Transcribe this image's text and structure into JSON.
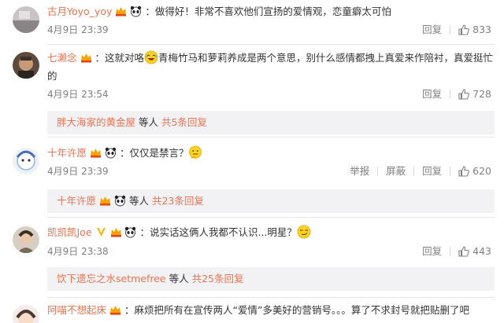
{
  "comments": [
    {
      "user": "古月Yoyo_yoy",
      "text": "：做得好！非常不喜欢他们宣扬的爱情观，恋童癖太可怕",
      "time": "4月9日 23:39",
      "reply_label": "回复",
      "likes": "833"
    },
    {
      "user": "七濑念",
      "text": "：这就对咯",
      "text2": "青梅竹马和萝莉养成是两个意思，别什么感情都拽上真爱来作陪衬，真爱挺忙的",
      "time": "4月9日 23:54",
      "reply_label": "回复",
      "likes": "728",
      "sub": {
        "user": "胖大海家的黄金屋",
        "mid": " 等人 ",
        "more": "共5条回复"
      }
    },
    {
      "user": "十年许愿",
      "text": "：仅仅是禁言？",
      "time": "4月9日 23:39",
      "report_label": "举报",
      "block_label": "屏蔽",
      "reply_label": "回复",
      "likes": "620",
      "sub": {
        "user": "十年许愿",
        "mid": " 等人 ",
        "more": "共23条回复"
      }
    },
    {
      "user": "凯凯凯Joe",
      "text": "：说实话这俩人我都不认识...明星？",
      "time": "4月9日 23:38",
      "reply_label": "回复",
      "likes": "443",
      "sub": {
        "user": "饮下遗忘之水setmefree",
        "mid": " 等人 ",
        "more": "共25条回复"
      }
    },
    {
      "user": "阿喵不想起床",
      "text": "：麻烦把所有在宣传两人“爱情”多美好的营销号。。。算了不求封号就把贴删了吧"
    }
  ],
  "icons": {
    "vip": "vip-crown-icon",
    "panda": "panda-icon",
    "like": "thumbs-up-icon",
    "verified": "v-verified-icon"
  },
  "colors": {
    "username": "#eb7350",
    "meta": "#808080",
    "reply_bg": "#f2f2f5"
  }
}
